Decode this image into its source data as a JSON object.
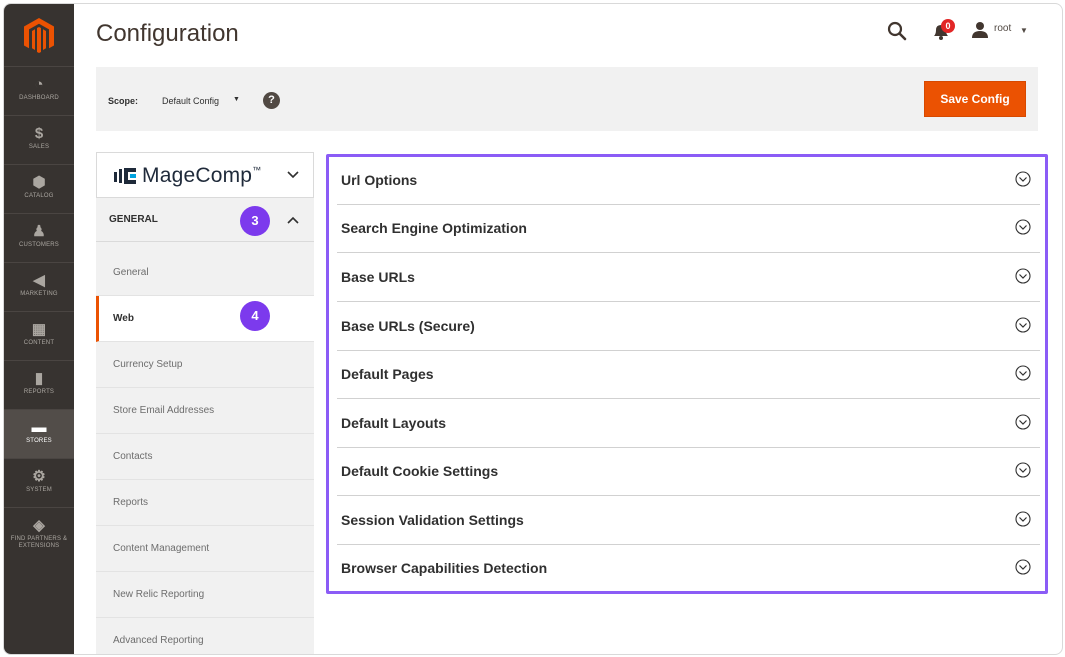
{
  "nav": {
    "items": [
      {
        "label": "DASHBOARD",
        "icon": "dashboard-icon"
      },
      {
        "label": "SALES",
        "icon": "dollar-icon"
      },
      {
        "label": "CATALOG",
        "icon": "box-icon"
      },
      {
        "label": "CUSTOMERS",
        "icon": "person-icon"
      },
      {
        "label": "MARKETING",
        "icon": "megaphone-icon"
      },
      {
        "label": "CONTENT",
        "icon": "content-icon"
      },
      {
        "label": "REPORTS",
        "icon": "bar-chart-icon"
      },
      {
        "label": "STORES",
        "icon": "store-icon"
      },
      {
        "label": "SYSTEM",
        "icon": "gear-icon"
      },
      {
        "label": "FIND PARTNERS & EXTENSIONS",
        "icon": "cube-icon"
      }
    ]
  },
  "header": {
    "title": "Configuration",
    "notification_count": "0",
    "username": "root"
  },
  "scope": {
    "label": "Scope:",
    "value": "Default Config",
    "help": "?",
    "save_label": "Save Config"
  },
  "tabs": {
    "brand": {
      "name": "MageComp",
      "tm": "™"
    },
    "section_title": "GENERAL",
    "section_step": "3",
    "active_step": "4",
    "items": [
      "General",
      "Web",
      "Currency Setup",
      "Store Email Addresses",
      "Contacts",
      "Reports",
      "Content Management",
      "New Relic Reporting",
      "Advanced Reporting"
    ]
  },
  "main": {
    "sections": [
      "Url Options",
      "Search Engine Optimization",
      "Base URLs",
      "Base URLs (Secure)",
      "Default Pages",
      "Default Layouts",
      "Default Cookie Settings",
      "Session Validation Settings",
      "Browser Capabilities Detection"
    ]
  },
  "colors": {
    "accent": "#eb5202",
    "highlight": "#8b5cf6",
    "nav_bg": "#373330"
  }
}
